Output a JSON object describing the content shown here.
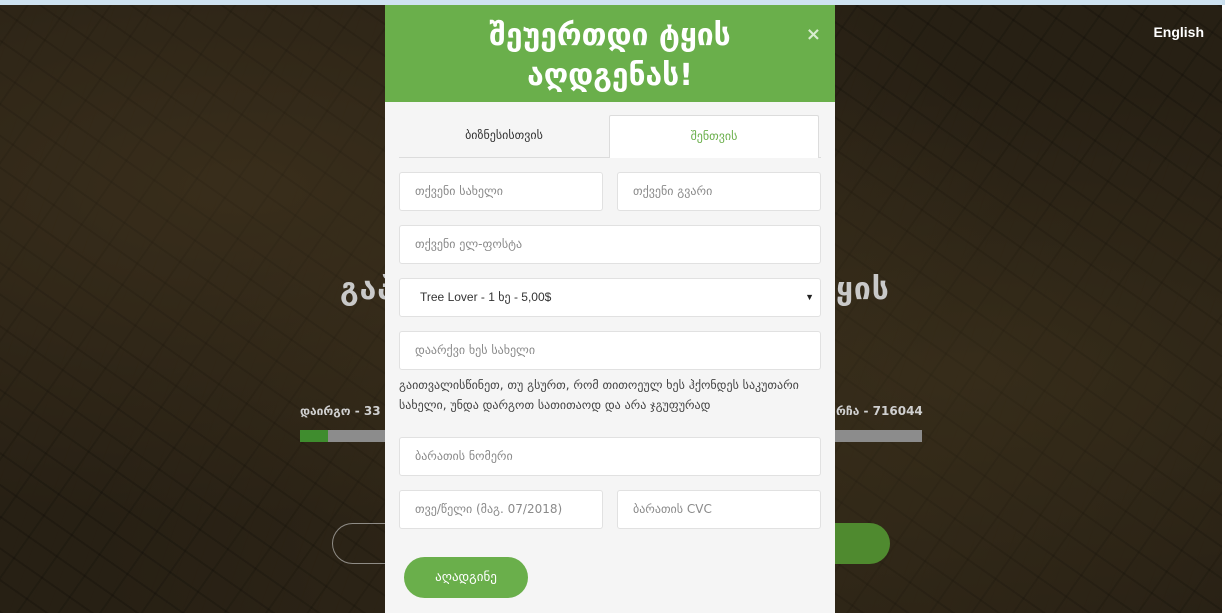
{
  "language_link": "English",
  "hero": {
    "title_left": "გაპ",
    "title_right": "ყის",
    "left_label": "დაირგო - 33",
    "right_label": "რჩა - 716044",
    "progress_fraction": 0.045
  },
  "modal": {
    "title_line1": "შეუერთდი ტყის",
    "title_line2": "აღდგენას!",
    "close_label": "×",
    "tabs": [
      {
        "label": "ბიზნესისთვის",
        "active": false
      },
      {
        "label": "შენთვის",
        "active": true
      }
    ],
    "fields": {
      "first_name_placeholder": "თქვენი სახელი",
      "last_name_placeholder": "თქვენი გვარი",
      "email_placeholder": "თქვენი ელ-ფოსტა",
      "plan_selected": "Tree Lover - 1 ხე - 5,00$",
      "tree_name_placeholder": "დაარქვი ხეს სახელი",
      "card_number_placeholder": "ბარათის ნომერი",
      "expiry_placeholder": "თვე/წელი (მაგ. 07/2018)",
      "cvc_placeholder": "ბარათის CVC"
    },
    "note": "გაითვალისწინეთ, თუ გსურთ, რომ თითოეულ ხეს ჰქონდეს საკუთარი სახელი, უნდა დარგოთ სათითაოდ და არა ჯგუფურად",
    "submit_label": "აღადგინე"
  },
  "colors": {
    "brand_green": "#6aaf4b",
    "progress_green": "#3f8c2e"
  }
}
